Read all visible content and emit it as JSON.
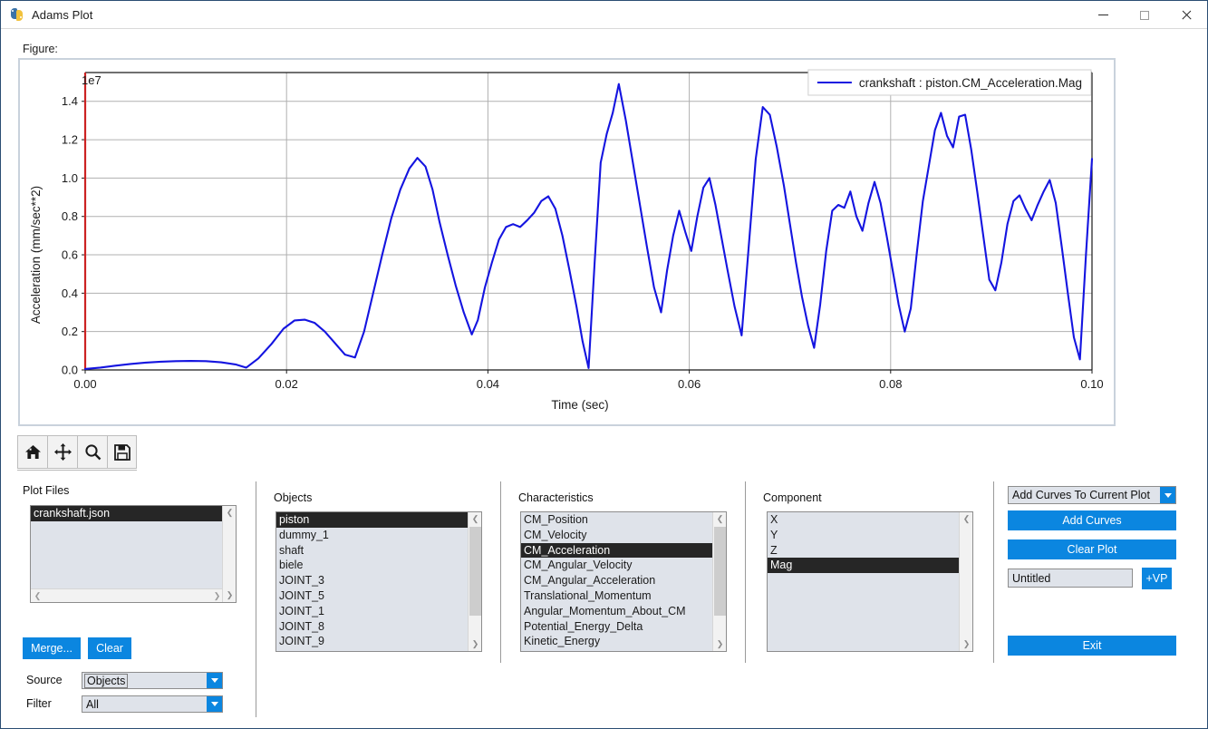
{
  "window": {
    "title": "Adams Plot",
    "app_icon": "python-logo-icon",
    "minimize_label": "",
    "maximize_label": "",
    "close_label": ""
  },
  "figure": {
    "label": "Figure:"
  },
  "toolbar": {
    "buttons": [
      {
        "name": "home-icon",
        "tooltip": "Home"
      },
      {
        "name": "pan-icon",
        "tooltip": "Pan"
      },
      {
        "name": "zoom-icon",
        "tooltip": "Zoom"
      },
      {
        "name": "save-icon",
        "tooltip": "Save"
      }
    ]
  },
  "panels": {
    "plot_files": {
      "label": "Plot Files",
      "items": [
        "crankshaft.json"
      ],
      "selected": "crankshaft.json",
      "merge_label": "Merge...",
      "clear_label": "Clear"
    },
    "objects": {
      "label": "Objects",
      "items": [
        "piston",
        "dummy_1",
        "shaft",
        "biele",
        "JOINT_3",
        "JOINT_5",
        "JOINT_1",
        "JOINT_8",
        "JOINT_9"
      ],
      "selected": "piston"
    },
    "characteristics": {
      "label": "Characteristics",
      "items": [
        "CM_Position",
        "CM_Velocity",
        "CM_Acceleration",
        "CM_Angular_Velocity",
        "CM_Angular_Acceleration",
        "Translational_Momentum",
        "Angular_Momentum_About_CM",
        "Potential_Energy_Delta",
        "Kinetic_Energy"
      ],
      "selected": "CM_Acceleration"
    },
    "component": {
      "label": "Component",
      "items": [
        "X",
        "Y",
        "Z",
        "Mag"
      ],
      "selected": "Mag"
    }
  },
  "actions": {
    "mode_select": "Add Curves To Current Plot",
    "add_curves_label": "Add Curves",
    "clear_plot_label": "Clear Plot",
    "viewport_name": "Untitled",
    "add_viewport_label": "+VP",
    "exit_label": "Exit"
  },
  "filters": {
    "source_label": "Source",
    "source_value": "Objects",
    "filter_label": "Filter",
    "filter_value": "All"
  },
  "colors": {
    "accent": "#0b86e0",
    "curve": "#1414e0",
    "selection": "#262626",
    "y_spine": "#cc2222",
    "grid": "#b0b0b0",
    "panel_border": "#c9d2dc"
  },
  "chart_data": {
    "type": "line",
    "title": "",
    "xlabel": "Time (sec)",
    "ylabel": "Acceleration (mm/sec**2)",
    "y_exponent_label": "1e7",
    "xlim": [
      0.0,
      0.1
    ],
    "ylim": [
      0.0,
      1.55
    ],
    "xticks": [
      "0.00",
      "0.02",
      "0.04",
      "0.06",
      "0.08",
      "0.10"
    ],
    "xtick_values": [
      0.0,
      0.02,
      0.04,
      0.06,
      0.08,
      0.1
    ],
    "yticks": [
      "0.0",
      "0.2",
      "0.4",
      "0.6",
      "0.8",
      "1.0",
      "1.2",
      "1.4"
    ],
    "ytick_values": [
      0.0,
      0.2,
      0.4,
      0.6,
      0.8,
      1.0,
      1.2,
      1.4
    ],
    "grid": true,
    "legend_position": "upper right",
    "series": [
      {
        "name": "crankshaft : piston.CM_Acceleration.Mag",
        "color": "#1414e0",
        "x": [
          0.0,
          0.0015,
          0.003,
          0.0045,
          0.006,
          0.0075,
          0.009,
          0.0105,
          0.012,
          0.0135,
          0.015,
          0.016,
          0.0172,
          0.0185,
          0.0197,
          0.0208,
          0.0218,
          0.0228,
          0.0238,
          0.0248,
          0.0258,
          0.0268,
          0.0277,
          0.0286,
          0.0295,
          0.0304,
          0.0313,
          0.0322,
          0.033,
          0.0338,
          0.0345,
          0.0352,
          0.036,
          0.0368,
          0.0376,
          0.0384,
          0.039,
          0.0397,
          0.0404,
          0.0411,
          0.0418,
          0.0425,
          0.0432,
          0.0439,
          0.0446,
          0.0453,
          0.046,
          0.0467,
          0.0474,
          0.0481,
          0.0488,
          0.0494,
          0.05,
          0.0506,
          0.0512,
          0.0518,
          0.0524,
          0.053,
          0.0537,
          0.0544,
          0.0551,
          0.0558,
          0.0565,
          0.0572,
          0.0578,
          0.0584,
          0.059,
          0.0596,
          0.0602,
          0.0608,
          0.0614,
          0.062,
          0.0626,
          0.0632,
          0.0638,
          0.0645,
          0.0652,
          0.0659,
          0.0666,
          0.0673,
          0.068,
          0.0687,
          0.0694,
          0.07,
          0.0706,
          0.0712,
          0.0718,
          0.0724,
          0.073,
          0.0736,
          0.0742,
          0.0748,
          0.0754,
          0.076,
          0.0766,
          0.0772,
          0.0778,
          0.0784,
          0.079,
          0.0796,
          0.0802,
          0.0808,
          0.0814,
          0.082,
          0.0826,
          0.0832,
          0.0838,
          0.0844,
          0.085,
          0.0856,
          0.0862,
          0.0868,
          0.0874,
          0.088,
          0.0886,
          0.0892,
          0.0898,
          0.0904,
          0.091,
          0.0916,
          0.0922,
          0.0928,
          0.0934,
          0.094,
          0.0946,
          0.0952,
          0.0958,
          0.0964,
          0.097,
          0.0976,
          0.0982,
          0.0988,
          0.0994,
          0.1
        ],
        "y": [
          0.005,
          0.012,
          0.022,
          0.031,
          0.038,
          0.043,
          0.046,
          0.047,
          0.046,
          0.04,
          0.028,
          0.012,
          0.06,
          0.135,
          0.215,
          0.258,
          0.262,
          0.245,
          0.2,
          0.14,
          0.08,
          0.065,
          0.2,
          0.4,
          0.6,
          0.79,
          0.94,
          1.05,
          1.105,
          1.06,
          0.94,
          0.77,
          0.6,
          0.44,
          0.3,
          0.185,
          0.26,
          0.43,
          0.56,
          0.68,
          0.745,
          0.76,
          0.745,
          0.78,
          0.82,
          0.88,
          0.905,
          0.84,
          0.7,
          0.52,
          0.33,
          0.15,
          0.01,
          0.56,
          1.08,
          1.23,
          1.34,
          1.49,
          1.3,
          1.08,
          0.86,
          0.64,
          0.43,
          0.3,
          0.52,
          0.7,
          0.83,
          0.72,
          0.62,
          0.8,
          0.95,
          1.0,
          0.86,
          0.69,
          0.52,
          0.33,
          0.18,
          0.64,
          1.1,
          1.37,
          1.33,
          1.16,
          0.96,
          0.76,
          0.56,
          0.38,
          0.23,
          0.115,
          0.34,
          0.62,
          0.83,
          0.86,
          0.845,
          0.93,
          0.8,
          0.725,
          0.87,
          0.98,
          0.87,
          0.7,
          0.52,
          0.34,
          0.2,
          0.32,
          0.61,
          0.88,
          1.065,
          1.25,
          1.34,
          1.22,
          1.16,
          1.32,
          1.33,
          1.15,
          0.93,
          0.7,
          0.47,
          0.415,
          0.56,
          0.76,
          0.88,
          0.91,
          0.84,
          0.78,
          0.86,
          0.93,
          0.99,
          0.87,
          0.64,
          0.4,
          0.17,
          0.055,
          0.6,
          1.1
        ]
      }
    ]
  }
}
